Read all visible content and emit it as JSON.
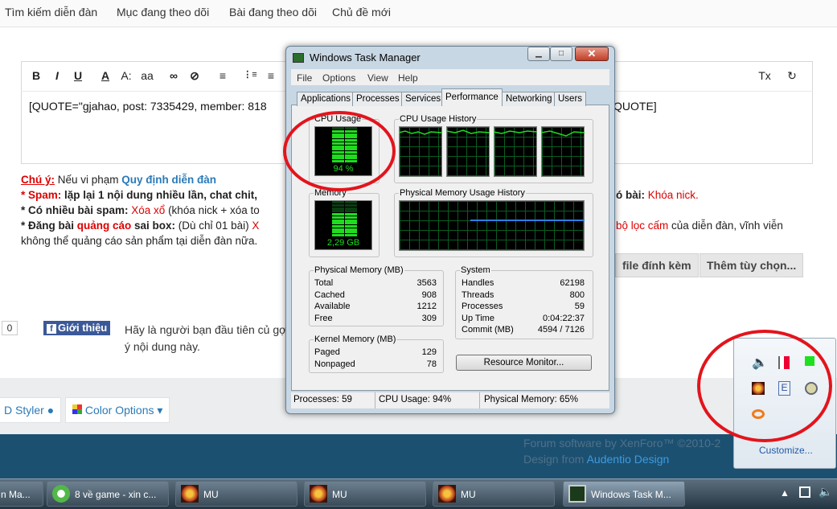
{
  "forum": {
    "nav": [
      "Tìm kiếm diễn đàn",
      "Mục đang theo dõi",
      "Bài đang theo dõi",
      "Chủ đề mới"
    ],
    "editor_toolbar": [
      "B",
      "I",
      "U",
      "A",
      "A:",
      "aa",
      "∞",
      "⊘",
      "≡",
      "⋮≡",
      "≡",
      "⊞",
      "⊟",
      "Tx",
      "↻"
    ],
    "editor_text": "[QUOTE=\"gjahao, post: 7335429, member: 818",
    "editor_text_end": "QUOTE]",
    "rules": {
      "notice_label": "Chú ý:",
      "notice_text": " Nếu vi phạm ",
      "notice_link": "Quy định diễn đàn",
      "spam_label": "* Spam:",
      "spam_text": " lặp lại 1 nội dung nhiều lần, chat chit,",
      "spam_end_label": "ó bài:",
      "spam_end_value": " Khóa nick.",
      "many_spam_label": "* Có nhiều bài spam:",
      "many_spam_value": " Xóa xổ",
      "many_spam_text": " (khóa nick + xóa to",
      "ad_label": "* Đăng bài ",
      "ad_red": "quảng cáo",
      "ad_label2": " sai box:",
      "ad_text": " (Dù chỉ 01 bài) ",
      "ad_cut": "X",
      "ad_filter": "bộ lọc cấm",
      "ad_end": " của diễn đàn, vĩnh viễn",
      "ad_line2": "không thể quảng cáo sản phẩm tại diễn đàn nữa."
    },
    "buttons": {
      "attach": "file đính kèm",
      "more": "Thêm tùy chọn..."
    },
    "like_count": "0",
    "fb_share": "Giới thiệu",
    "share_text": "Hãy là người bạn đầu tiên củ gợi ý nội dung này.",
    "styler": "D Styler",
    "color_options": "Color Options",
    "footer_software": "Forum software by XenForo™ ©2010-2",
    "footer_design": "Design from ",
    "footer_design_link": "Audentio Design"
  },
  "taskbar": {
    "items": [
      "n Ma...",
      "8 về game - xin c...",
      "MU",
      "MU",
      "MU",
      "Windows Task M..."
    ]
  },
  "tray_overflow": {
    "customize": "Customize..."
  },
  "task_manager": {
    "title": "Windows Task Manager",
    "menu": [
      "File",
      "Options",
      "View",
      "Help"
    ],
    "tabs": [
      "Applications",
      "Processes",
      "Services",
      "Performance",
      "Networking",
      "Users"
    ],
    "active_tab": "Performance",
    "cpu_usage_label": "CPU Usage",
    "cpu_usage_value": "94 %",
    "cpu_percent": 94,
    "cpu_history_label": "CPU Usage History",
    "memory_label": "Memory",
    "memory_value": "2,29 GB",
    "memory_percent": 65,
    "mem_history_label": "Physical Memory Usage History",
    "physical_memory": {
      "label": "Physical Memory (MB)",
      "rows": [
        {
          "name": "Total",
          "value": "3563"
        },
        {
          "name": "Cached",
          "value": "908"
        },
        {
          "name": "Available",
          "value": "1212"
        },
        {
          "name": "Free",
          "value": "309"
        }
      ]
    },
    "kernel_memory": {
      "label": "Kernel Memory (MB)",
      "rows": [
        {
          "name": "Paged",
          "value": "129"
        },
        {
          "name": "Nonpaged",
          "value": "78"
        }
      ]
    },
    "system": {
      "label": "System",
      "rows": [
        {
          "name": "Handles",
          "value": "62198"
        },
        {
          "name": "Threads",
          "value": "800"
        },
        {
          "name": "Processes",
          "value": "59"
        },
        {
          "name": "Up Time",
          "value": "0:04:22:37"
        },
        {
          "name": "Commit (MB)",
          "value": "4594 / 7126"
        }
      ]
    },
    "resource_monitor": "Resource Monitor...",
    "status": {
      "processes": "Processes: 59",
      "cpu": "CPU Usage: 94%",
      "memory": "Physical Memory: 65%"
    }
  },
  "colors": {
    "annotation": "#e3141c",
    "graph_green": "#1fdc1f",
    "taskbar": "#243542"
  }
}
